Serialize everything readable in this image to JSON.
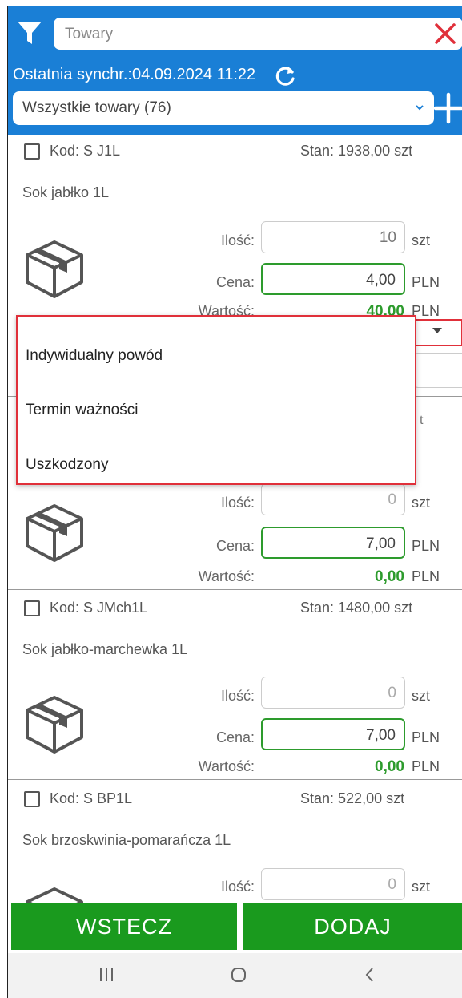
{
  "header": {
    "search_placeholder": "Towary",
    "sync_label": "Ostatnia synchr.:04.09.2024 11:22",
    "filter_select": "Wszystkie towary (76)"
  },
  "labels": {
    "qty": "Ilość:",
    "price": "Cena:",
    "value": "Wartość:",
    "unit_szt": "szt",
    "unit_pln": "PLN"
  },
  "products": [
    {
      "code": "Kod: S J1L",
      "stock": "Stan: 1938,00 szt",
      "name": "Sok jabłko 1L",
      "qty": "10",
      "price": "4,00",
      "value": "40,00"
    },
    {
      "qty": "0",
      "price": "7,00",
      "value": "0,00"
    },
    {
      "code": "Kod: S JMch1L",
      "stock": "Stan: 1480,00 szt",
      "name": "Sok jabłko-marchewka 1L",
      "qty": "0",
      "price": "7,00",
      "value": "0,00"
    },
    {
      "code": "Kod: S BP1L",
      "stock": "Stan: 522,00 szt",
      "name": "Sok brzoskwinia-pomarańcza 1L",
      "qty": "0"
    }
  ],
  "reason_dropdown": {
    "options": [
      "Indywidualny powód",
      "Termin ważności",
      "Uszkodzony"
    ],
    "peek_text": "t"
  },
  "buttons": {
    "back": "WSTECZ",
    "add": "DODAJ"
  },
  "colors": {
    "primary_blue": "#1a7fd6",
    "green": "#1a9a1e",
    "highlight_red": "#e0303a"
  }
}
